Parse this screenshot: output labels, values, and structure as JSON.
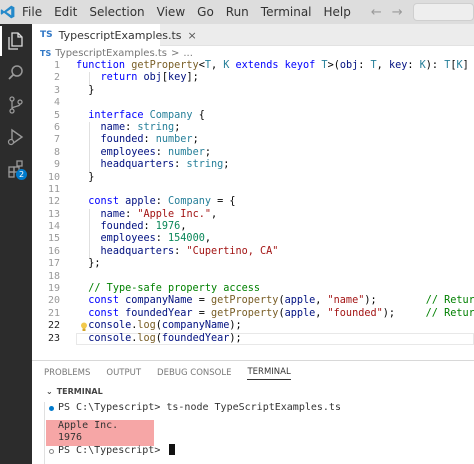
{
  "menu": [
    "File",
    "Edit",
    "Selection",
    "View",
    "Go",
    "Run",
    "Terminal",
    "Help"
  ],
  "nav": {
    "back": "←",
    "forward": "→"
  },
  "activity": {
    "extensions_badge": "2"
  },
  "tab": {
    "icon": "TS",
    "name": "TypescriptExamples.ts",
    "close": "×"
  },
  "breadcrumb": {
    "icon": "TS",
    "file": "TypescriptExamples.ts",
    "sep": ">",
    "more": "..."
  },
  "editor": {
    "line_numbers": [
      "1",
      "2",
      "3",
      "4",
      "5",
      "6",
      "7",
      "8",
      "9",
      "10",
      "11",
      "12",
      "13",
      "14",
      "15",
      "16",
      "17",
      "18",
      "19",
      "20",
      "21",
      "22",
      "23"
    ],
    "current_line": "23"
  },
  "panel": {
    "tabs": [
      "PROBLEMS",
      "OUTPUT",
      "DEBUG CONSOLE",
      "TERMINAL"
    ],
    "active_tab": "TERMINAL",
    "section_label": "TERMINAL",
    "terminal_lines": [
      "PS C:\\Typescript> ts-node TypeScriptExamples.ts",
      "Apple Inc.",
      "1976",
      "PS C:\\Typescript> "
    ]
  },
  "colors": {
    "keyword": "#0000ff",
    "type": "#267f99",
    "function": "#795e26",
    "string": "#a31515",
    "number": "#098658",
    "comment": "#008000",
    "highlight": "#f6a6a6"
  }
}
